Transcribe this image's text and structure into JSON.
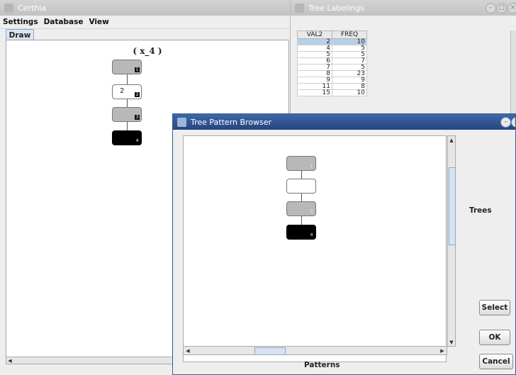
{
  "certhia": {
    "title": "Certhia",
    "menu": [
      "Settings",
      "Database",
      "View"
    ],
    "tab": "Draw",
    "tree_title": "( x_4 )",
    "nodes": [
      {
        "label": "",
        "badge": "1",
        "fill": "gray"
      },
      {
        "label": "2",
        "badge": "2",
        "fill": "white"
      },
      {
        "label": "",
        "badge": "3",
        "fill": "gray"
      },
      {
        "label": "",
        "badge": "4",
        "fill": "black"
      }
    ]
  },
  "labelings": {
    "title": "Tree Labelings",
    "columns": [
      "VAL2",
      "FREQ"
    ],
    "rows": [
      [
        "2",
        "10"
      ],
      [
        "4",
        "5"
      ],
      [
        "5",
        "5"
      ],
      [
        "6",
        "7"
      ],
      [
        "7",
        "5"
      ],
      [
        "8",
        "23"
      ],
      [
        "9",
        "9"
      ],
      [
        "11",
        "8"
      ],
      [
        "15",
        "10"
      ]
    ],
    "selected_row": 0
  },
  "browser": {
    "title": "Tree Pattern Browser",
    "trees_label": "Trees",
    "patterns_label": "Patterns",
    "select_label": "Select",
    "ok_label": "OK",
    "cancel_label": "Cancel",
    "nodes": [
      {
        "badge": "1",
        "fill": "gray"
      },
      {
        "badge": "",
        "fill": "white"
      },
      {
        "badge": "3",
        "fill": "gray"
      },
      {
        "badge": "4",
        "fill": "black"
      }
    ]
  },
  "colors": {
    "active_titlebar": "#2f5492",
    "inactive_titlebar": "#c8c8c8",
    "node_gray": "#b8b8b8",
    "node_black": "#000000",
    "selection": "#b8cfe8"
  }
}
